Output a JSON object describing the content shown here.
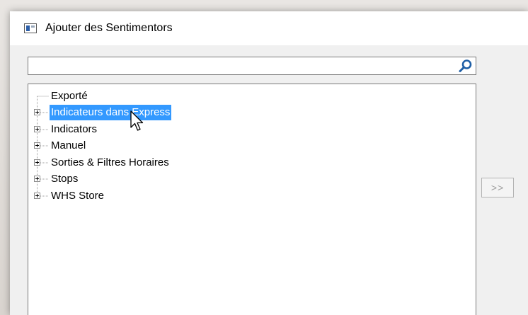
{
  "window": {
    "title": "Ajouter des Sentimentors",
    "icon": "app-window-icon"
  },
  "search": {
    "value": "",
    "placeholder": "",
    "icon": "search-icon"
  },
  "tree": {
    "items": [
      {
        "label": "Exporté",
        "expandable": false,
        "selected": false
      },
      {
        "label": "Indicateurs dans Express",
        "expandable": true,
        "selected": true
      },
      {
        "label": "Indicators",
        "expandable": true,
        "selected": false
      },
      {
        "label": "Manuel",
        "expandable": true,
        "selected": false
      },
      {
        "label": "Sorties & Filtres Horaires",
        "expandable": true,
        "selected": false
      },
      {
        "label": "Stops",
        "expandable": true,
        "selected": false
      },
      {
        "label": "WHS Store",
        "expandable": true,
        "selected": false
      }
    ]
  },
  "add_button": {
    "label": ">>",
    "enabled": false
  },
  "colors": {
    "selection": "#3399ff",
    "window_bg": "#f0f0f0",
    "search_icon": "#1f5fa6"
  }
}
